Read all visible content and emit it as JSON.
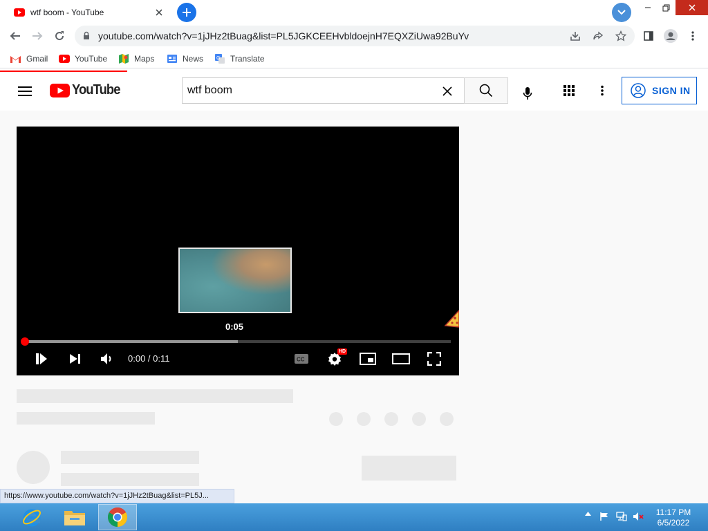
{
  "browser": {
    "tab": {
      "title": "wtf boom - YouTube"
    },
    "omnibox": {
      "url": "youtube.com/watch?v=1jJHz2tBuag&list=PL5JGKCEEHvbldoejnH7EQXZiUwa92BuYv"
    },
    "bookmarks": [
      {
        "label": "Gmail",
        "icon": "gmail-icon"
      },
      {
        "label": "YouTube",
        "icon": "youtube-icon"
      },
      {
        "label": "Maps",
        "icon": "maps-icon"
      },
      {
        "label": "News",
        "icon": "news-icon"
      },
      {
        "label": "Translate",
        "icon": "translate-icon"
      }
    ],
    "status_link": "https://www.youtube.com/watch?v=1jJHz2tBuag&list=PL5J..."
  },
  "youtube": {
    "logo_text": "YouTube",
    "search": {
      "value": "wtf boom"
    },
    "signin_label": "SIGN IN",
    "accent": "#ff0000",
    "link_blue": "#065fd4"
  },
  "player": {
    "hover_time": "0:05",
    "time_display": "0:00 / 0:11",
    "played_fraction": 0,
    "hover_fraction": 0.5,
    "settings_badge": "HD"
  },
  "taskbar": {
    "apps": [
      {
        "icon": "internet-explorer-icon"
      },
      {
        "icon": "file-explorer-icon"
      },
      {
        "icon": "chrome-icon",
        "active": true
      }
    ],
    "clock": {
      "time": "11:17 PM",
      "date": "6/5/2022"
    }
  }
}
